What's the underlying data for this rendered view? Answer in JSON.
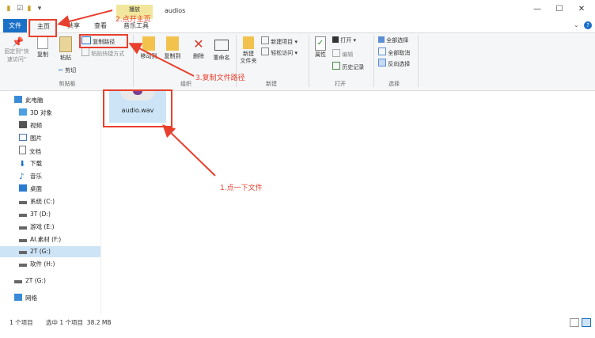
{
  "window": {
    "title": "audios",
    "context_tab": "播放",
    "controls": [
      "—",
      "☐",
      "✕"
    ]
  },
  "tabs": [
    {
      "label": "文件"
    },
    {
      "label": "主页"
    },
    {
      "label": "共享"
    },
    {
      "label": "查看"
    },
    {
      "label": "音乐工具"
    }
  ],
  "ribbon": {
    "clipboard": {
      "pin_label": "固定到\"快\n速访问\"",
      "copy_label": "复制",
      "paste_label": "粘贴",
      "copy_path_label": "复制路径",
      "paste_shortcut_label": "粘贴快捷方式",
      "cut_label": "剪切",
      "group_label": "剪贴板"
    },
    "organize": {
      "move_to_label": "移动到",
      "copy_to_label": "复制到",
      "delete_label": "删除",
      "rename_label": "重命名",
      "group_label": "组织"
    },
    "new": {
      "new_folder_label": "新建\n文件夹",
      "new_item_label": "新建项目",
      "easy_access_label": "轻松访问",
      "group_label": "新建"
    },
    "open": {
      "properties_label": "属性",
      "open_label": "打开",
      "edit_label": "编辑",
      "history_label": "历史记录",
      "group_label": "打开"
    },
    "select": {
      "select_all_label": "全部选择",
      "select_none_label": "全部取消",
      "invert_label": "反向选择",
      "group_label": "选择"
    }
  },
  "nav": [
    {
      "label": "此电脑"
    },
    {
      "label": "3D 对象"
    },
    {
      "label": "视频"
    },
    {
      "label": "图片"
    },
    {
      "label": "文档"
    },
    {
      "label": "下载"
    },
    {
      "label": "音乐"
    },
    {
      "label": "桌面"
    },
    {
      "label": "系统 (C:)"
    },
    {
      "label": "3T (D:)"
    },
    {
      "label": "游戏 (E:)"
    },
    {
      "label": "AI.素材 (F:)"
    },
    {
      "label": "2T (G:)"
    },
    {
      "label": "软件 (H:)"
    },
    {
      "label": "2T (G:)"
    },
    {
      "label": "网络"
    }
  ],
  "file": {
    "name": "audio.wav"
  },
  "status": {
    "count": "1 个项目",
    "selected": "选中 1 个项目  38.2 MB"
  },
  "annotations": {
    "step1": "1.点一下文件",
    "step2": "2.点开主页",
    "step3": "3.复制文件路径"
  },
  "colors": {
    "accent": "#1a6fc7",
    "annotation": "#e8402e"
  }
}
